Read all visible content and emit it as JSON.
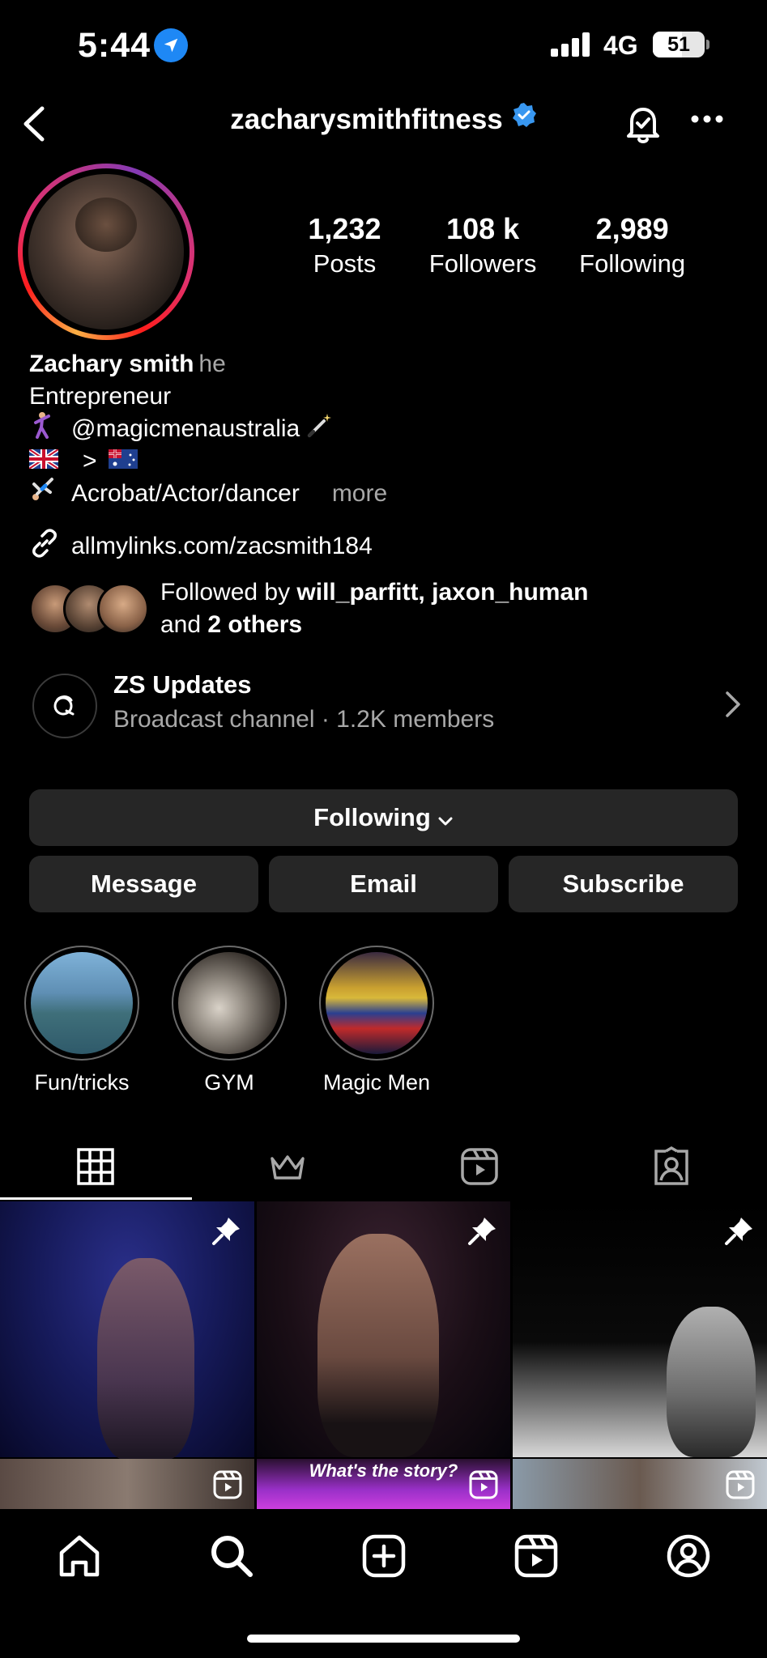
{
  "status_bar": {
    "time": "5:44",
    "network": "4G",
    "battery": "51"
  },
  "header": {
    "username": "zacharysmithfitness",
    "verified": true
  },
  "profile": {
    "stats": [
      {
        "value": "1,232",
        "label": "Posts"
      },
      {
        "value": "108 k",
        "label": "Followers"
      },
      {
        "value": "2,989",
        "label": "Following"
      }
    ]
  },
  "bio": {
    "name": "Zachary smith",
    "pronouns": "he",
    "category": "Entrepreneur",
    "line1": "@magicmenaustralia",
    "line2": ">",
    "line3": "Acrobat/Actor/dancer",
    "more": "more",
    "link": "allmylinks.com/zacsmith184"
  },
  "followed_by": {
    "prefix": "Followed by ",
    "users": "will_parfitt, jaxon_human",
    "and": "and ",
    "others": "2 others"
  },
  "broadcast": {
    "title": "ZS Updates",
    "subtitle": "Broadcast channel · 1.2K members"
  },
  "buttons": {
    "following": "Following",
    "message": "Message",
    "email": "Email",
    "subscribe": "Subscribe"
  },
  "highlights": [
    {
      "label": "Fun/tricks"
    },
    {
      "label": "GYM"
    },
    {
      "label": "Magic Men"
    }
  ],
  "posts": {
    "caption_2": "What's the story?"
  },
  "colors": {
    "background": "#000000",
    "button": "#262626",
    "secondary_text": "#a8a8a8",
    "verified": "#3897f0",
    "location": "#1e88f5"
  }
}
